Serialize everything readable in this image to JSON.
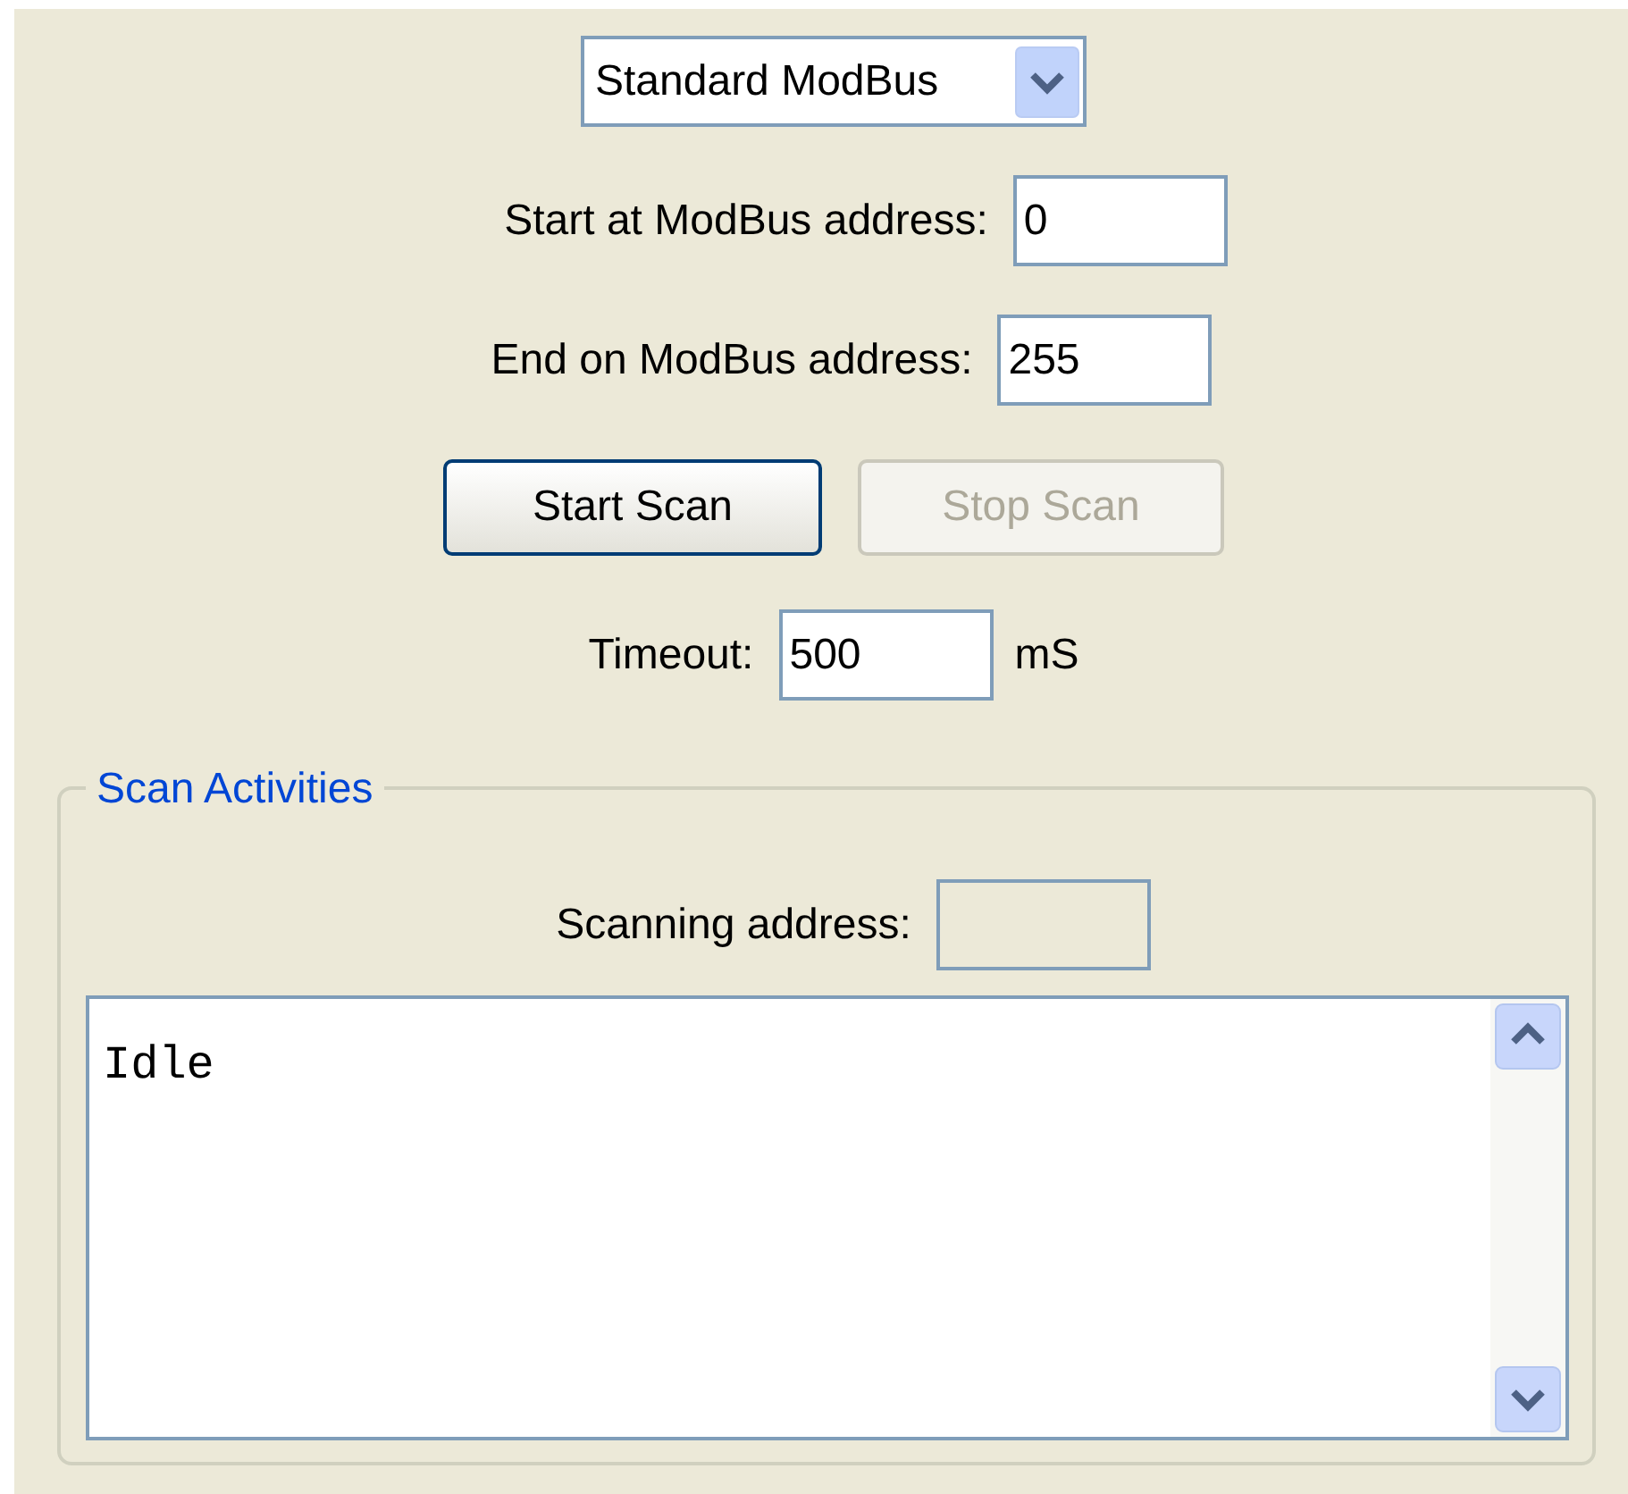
{
  "mode_select": {
    "value": "Standard ModBus"
  },
  "fields": [
    {
      "label": "Start at ModBus address:",
      "value": "0"
    },
    {
      "label": "End on ModBus address:",
      "value": "255"
    }
  ],
  "buttons": [
    {
      "label": "Start Scan",
      "disabled": false
    },
    {
      "label": "Stop Scan",
      "disabled": true
    }
  ],
  "timeout": {
    "label": "Timeout:",
    "value": "500",
    "unit": "mS"
  },
  "scan_activities": {
    "title": "Scan Activities",
    "scanning_address": {
      "label": "Scanning address:"
    },
    "log": {
      "value": "Idle"
    }
  }
}
